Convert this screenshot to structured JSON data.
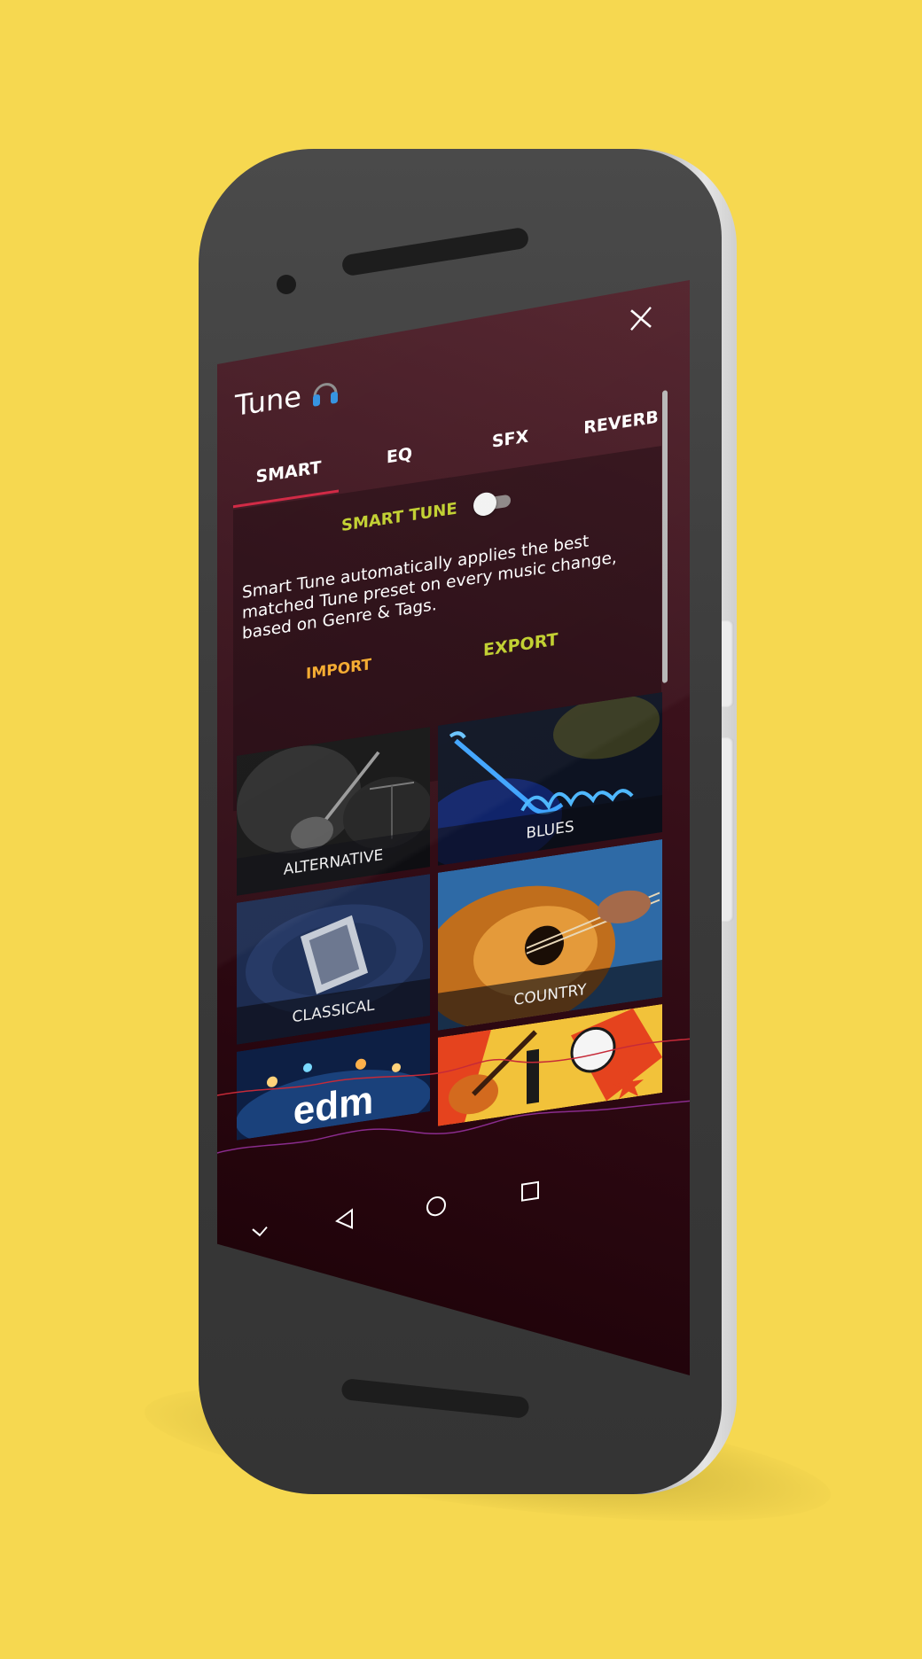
{
  "app": {
    "title": "Tune",
    "headphones_icon": "headphones-icon",
    "close_icon": "close-icon"
  },
  "tabs": [
    {
      "label": "SMART",
      "active": true
    },
    {
      "label": "EQ",
      "active": false
    },
    {
      "label": "SFX",
      "active": false
    },
    {
      "label": "REVERB",
      "active": false
    }
  ],
  "smart": {
    "toggle_label": "SMART TUNE",
    "toggle_on": false,
    "description": "Smart Tune automatically applies the best matched Tune preset on every music change, based on Genre & Tags.",
    "import_label": "IMPORT",
    "export_label": "EXPORT"
  },
  "genres": [
    {
      "label": "ALTERNATIVE"
    },
    {
      "label": "BLUES"
    },
    {
      "label": "CLASSICAL"
    },
    {
      "label": "COUNTRY"
    },
    {
      "label": "edm"
    },
    {
      "label": ""
    }
  ],
  "nav": {
    "collapse_icon": "chevron-down-icon",
    "back_icon": "back-triangle-icon",
    "home_icon": "home-circle-icon",
    "recents_icon": "recents-square-icon"
  },
  "colors": {
    "background": "#f6d850",
    "accent_green": "#c0cf2c",
    "accent_orange": "#f4a92b",
    "tab_indicator": "#d0213e",
    "screen_top": "#4f1e28",
    "screen_bottom": "#1b0207"
  }
}
